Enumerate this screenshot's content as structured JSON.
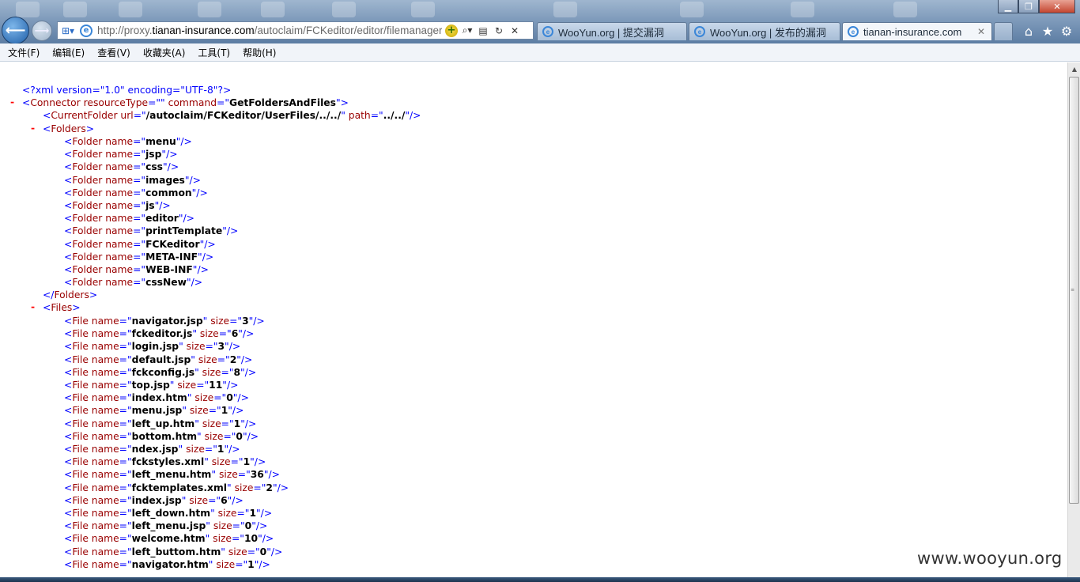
{
  "browser": {
    "url_prefix": "http://proxy.",
    "url_domain": "tianan-insurance.com",
    "url_suffix": "/autoclaim/FCKeditor/editor/filemanager",
    "tabs": [
      {
        "label": "WooYun.org | 提交漏洞"
      },
      {
        "label": "WooYun.org | 发布的漏洞"
      },
      {
        "label": "tianan-insurance.com"
      }
    ],
    "icons": {
      "back": "back-arrow-icon",
      "forward": "forward-arrow-icon",
      "home": "home-icon",
      "favorites": "star-icon",
      "tools": "gear-icon"
    }
  },
  "menu": [
    "文件(F)",
    "编辑(E)",
    "查看(V)",
    "收藏夹(A)",
    "工具(T)",
    "帮助(H)"
  ],
  "xml": {
    "declaration": "<?xml version=\"1.0\" encoding=\"UTF-8\"?>",
    "connector": {
      "resourceType": "",
      "command": "GetFoldersAndFiles"
    },
    "current_folder": {
      "url": "/autoclaim/FCKeditor/UserFiles/../../",
      "path": "../../"
    },
    "folders": [
      "menu",
      "jsp",
      "css",
      "images",
      "common",
      "js",
      "editor",
      "printTemplate",
      "FCKeditor",
      "META-INF",
      "WEB-INF",
      "cssNew"
    ],
    "files": [
      {
        "name": "navigator.jsp",
        "size": "3"
      },
      {
        "name": "fckeditor.js",
        "size": "6"
      },
      {
        "name": "login.jsp",
        "size": "3"
      },
      {
        "name": "default.jsp",
        "size": "2"
      },
      {
        "name": "fckconfig.js",
        "size": "8"
      },
      {
        "name": "top.jsp",
        "size": "11"
      },
      {
        "name": "index.htm",
        "size": "0"
      },
      {
        "name": "menu.jsp",
        "size": "1"
      },
      {
        "name": "left_up.htm",
        "size": "1"
      },
      {
        "name": "bottom.htm",
        "size": "0"
      },
      {
        "name": "ndex.jsp",
        "size": "1"
      },
      {
        "name": "fckstyles.xml",
        "size": "1"
      },
      {
        "name": "left_menu.htm",
        "size": "36"
      },
      {
        "name": "fcktemplates.xml",
        "size": "2"
      },
      {
        "name": "index.jsp",
        "size": "6"
      },
      {
        "name": "left_down.htm",
        "size": "1"
      },
      {
        "name": "left_menu.jsp",
        "size": "0"
      },
      {
        "name": "welcome.htm",
        "size": "10"
      },
      {
        "name": "left_buttom.htm",
        "size": "0"
      },
      {
        "name": "navigator.htm",
        "size": "1"
      }
    ]
  },
  "watermark": "www.wooyun.org",
  "colors": {
    "tag": "#990000",
    "punct": "#0000ff",
    "minus": "#ff0000"
  }
}
